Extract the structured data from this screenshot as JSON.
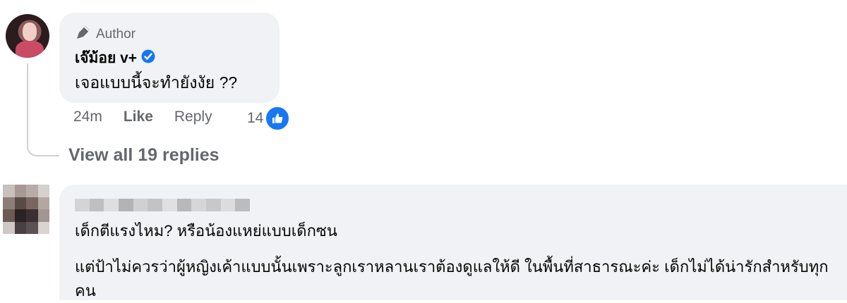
{
  "comment1": {
    "author_badge": "Author",
    "name": "เจ๊ม้อย v+",
    "text": "เจอแบบนี้จะทำยังงัย ??",
    "time": "24m",
    "like_label": "Like",
    "reply_label": "Reply",
    "reaction_count": "14"
  },
  "view_replies": "View all 19 replies",
  "comment2": {
    "line1": "เด็กตีแรงไหม? หรือน้องแหย่แบบเด็กซน",
    "line2": "แต่ป้าไม่ควรว่าผู้หญิงเค้าแบบนั้นเพราะลูกเราหลานเราต้องดูแลให้ดี ในพื้นที่สาธารณะค่ะ เด็กไม่ได้น่ารักสำหรับทุกคน"
  },
  "colors": {
    "bubble": "#f0f2f5",
    "meta": "#65676b",
    "accent": "#1877f2"
  },
  "icons": [
    "pen-icon",
    "verified-icon",
    "like-icon"
  ]
}
